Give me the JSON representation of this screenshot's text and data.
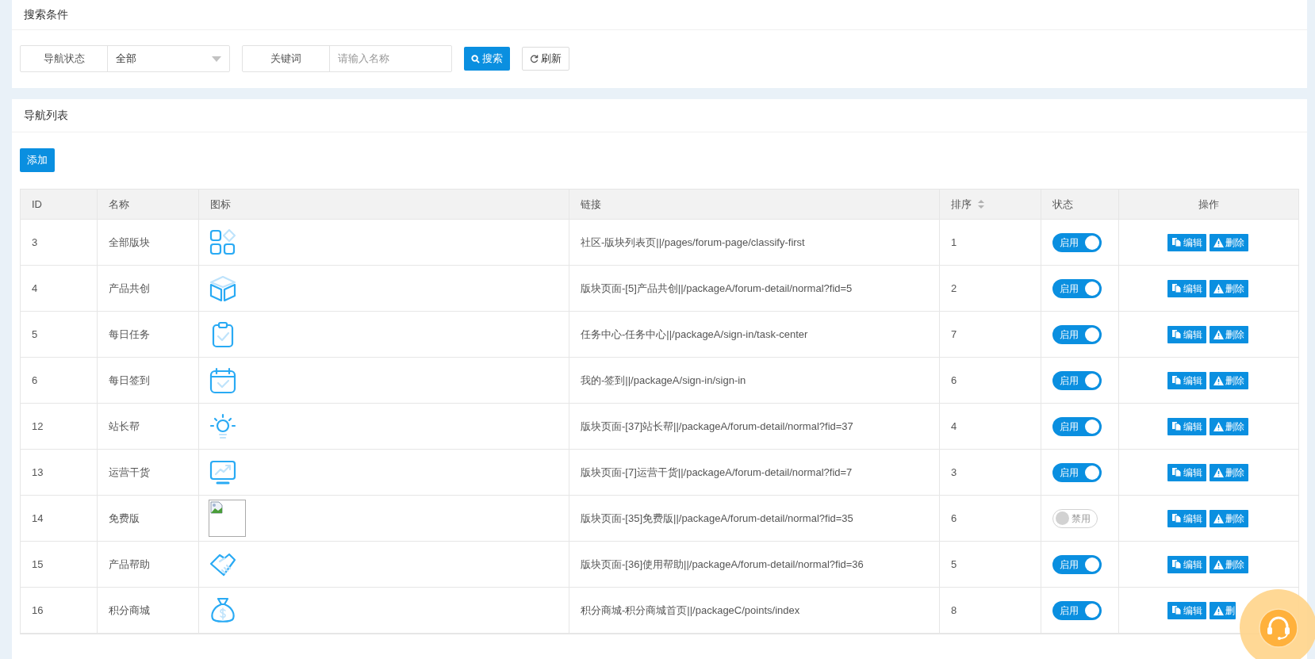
{
  "search_panel": {
    "title": "搜索条件",
    "status_filter": {
      "label": "导航状态",
      "value": "全部"
    },
    "keyword_filter": {
      "label": "关键词",
      "placeholder": "请输入名称"
    },
    "buttons": {
      "search": "搜索",
      "refresh": "刷新"
    }
  },
  "list_panel": {
    "title": "导航列表",
    "add_button": "添加",
    "table": {
      "columns": [
        "ID",
        "名称",
        "图标",
        "链接",
        "排序",
        "状态",
        "操作"
      ],
      "rows": [
        {
          "id": "3",
          "name": "全部版块",
          "link": "社区-版块列表页||/pages/forum-page/classify-first",
          "order": "1",
          "on": true,
          "status": "启用",
          "edit": "编辑",
          "delete": "删除"
        },
        {
          "id": "4",
          "name": "产品共创",
          "link": "版块页面-[5]产品共创||/packageA/forum-detail/normal?fid=5",
          "order": "2",
          "on": true,
          "status": "启用",
          "edit": "编辑",
          "delete": "删除"
        },
        {
          "id": "5",
          "name": "每日任务",
          "link": "任务中心-任务中心||/packageA/sign-in/task-center",
          "order": "7",
          "on": true,
          "status": "启用",
          "edit": "编辑",
          "delete": "删除"
        },
        {
          "id": "6",
          "name": "每日签到",
          "link": "我的-签到||/packageA/sign-in/sign-in",
          "order": "6",
          "on": true,
          "status": "启用",
          "edit": "编辑",
          "delete": "删除"
        },
        {
          "id": "12",
          "name": "站长帮",
          "link": "版块页面-[37]站长帮||/packageA/forum-detail/normal?fid=37",
          "order": "4",
          "on": true,
          "status": "启用",
          "edit": "编辑",
          "delete": "删除"
        },
        {
          "id": "13",
          "name": "运营干货",
          "link": "版块页面-[7]运营干货||/packageA/forum-detail/normal?fid=7",
          "order": "3",
          "on": true,
          "status": "启用",
          "edit": "编辑",
          "delete": "删除"
        },
        {
          "id": "14",
          "name": "免费版",
          "link": "版块页面-[35]免费版||/packageA/forum-detail/normal?fid=35",
          "order": "6",
          "on": false,
          "status": "禁用",
          "edit": "编辑",
          "delete": "删除"
        },
        {
          "id": "15",
          "name": "产品帮助",
          "link": "版块页面-[36]使用帮助||/packageA/forum-detail/normal?fid=36",
          "order": "5",
          "on": true,
          "status": "启用",
          "edit": "编辑",
          "delete": "删除"
        },
        {
          "id": "16",
          "name": "积分商城",
          "link": "积分商城-积分商城首页||/packageC/points/index",
          "order": "8",
          "on": true,
          "status": "启用",
          "edit": "编辑",
          "delete": "删"
        }
      ]
    }
  }
}
